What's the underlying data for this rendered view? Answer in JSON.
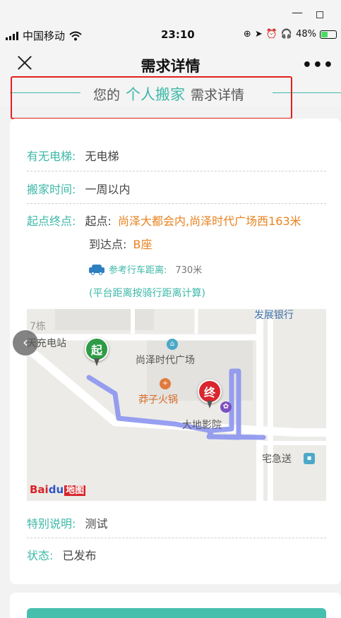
{
  "status_bar": {
    "carrier": "中国移动",
    "time": "23:10",
    "battery": "48%"
  },
  "nav": {
    "title": "需求详情",
    "more": "•••"
  },
  "heading": {
    "prefix": "您的",
    "service": "个人搬家",
    "suffix": "需求详情"
  },
  "details": {
    "elevator_label": "有无电梯:",
    "elevator_value": "无电梯",
    "time_label": "搬家时间:",
    "time_value": "一周以内",
    "route_label": "起点终点:",
    "start_label": "起点:",
    "start_value": "尚泽大都会内,尚泽时代广场西163米",
    "end_label": "到达点:",
    "end_value": "B座",
    "distance_label": "参考行车距离:",
    "distance_value": "730米",
    "distance_note": "(平台距离按骑行距离计算)",
    "special_label": "特别说明:",
    "special_value": "测试",
    "state_label": "状态:",
    "state_value": "已发布"
  },
  "map": {
    "labels": {
      "building7": "7栋",
      "tianchong": "天充电站",
      "bank": "发展银行",
      "plaza": "尚泽时代广场",
      "hotpot": "莽子火锅",
      "cinema": "大地影院",
      "express": "宅急送"
    },
    "start_pin": "起",
    "end_pin": "终",
    "logo": {
      "bai": "Bai",
      "du": "du",
      "ditu": "地图"
    }
  },
  "colors": {
    "accent": "#3db8a8",
    "highlight": "#e8821e",
    "route": "#8c95f0",
    "start_pin": "#2e9b47",
    "end_pin": "#d9262e"
  }
}
